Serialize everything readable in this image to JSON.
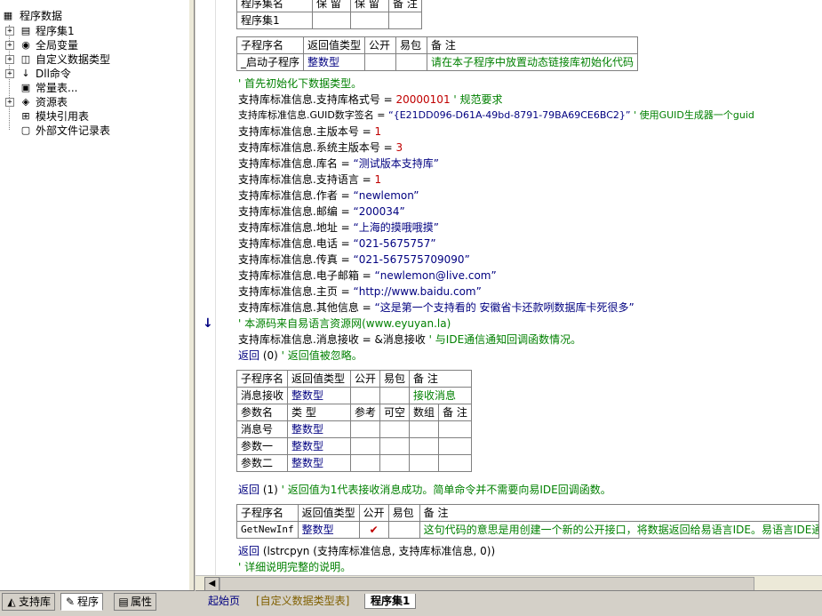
{
  "tree": {
    "root": "程序数据",
    "items": [
      {
        "label": "程序集1",
        "icon": "program-set-icon"
      },
      {
        "label": "全局变量",
        "icon": "global-var-icon"
      },
      {
        "label": "自定义数据类型",
        "icon": "custom-type-icon"
      },
      {
        "label": "Dll命令",
        "icon": "dll-icon"
      },
      {
        "label": "常量表...",
        "icon": "constant-icon"
      },
      {
        "label": "资源表",
        "icon": "resource-icon"
      },
      {
        "label": "模块引用表",
        "icon": "module-ref-icon"
      },
      {
        "label": "外部文件记录表",
        "icon": "external-file-icon"
      }
    ]
  },
  "left_tabs": [
    {
      "label": "支持库",
      "icon": "library-icon"
    },
    {
      "label": "程序",
      "icon": "program-icon"
    },
    {
      "label": "属性",
      "icon": "properties-icon"
    }
  ],
  "top_table": {
    "headers": [
      "程序集名",
      "保 留",
      "保 留",
      "备 注"
    ],
    "row": [
      "程序集1",
      "",
      "",
      ""
    ]
  },
  "sub1": {
    "headers": [
      "子程序名",
      "返回值类型",
      "公开",
      "易包",
      "备 注"
    ],
    "row": [
      "_启动子程序",
      "整数型",
      "",
      "",
      "请在本子程序中放置动态链接库初始化代码"
    ]
  },
  "code_lines": {
    "l1": "' 首先初始化下数据类型。",
    "l2a": "支持库标准信息.支持库格式号 = ",
    "l2b": "20000101",
    "l2c": "  ' 规范要求",
    "l3a": "支持库标准信息.GUID数字签名 = ",
    "l3b": "“{E21DD096-D61A-49bd-8791-79BA69CE6BC2}”",
    "l3c": "  ' 使用GUID生成器一个guid",
    "l4a": "支持库标准信息.主版本号 = ",
    "l4b": "1",
    "l5a": "支持库标准信息.系统主版本号 = ",
    "l5b": "3",
    "l6a": "支持库标准信息.库名 = ",
    "l6b": "“测试版本支持库”",
    "l7a": "支持库标准信息.支持语言 = ",
    "l7b": "1",
    "l8a": "支持库标准信息.作者 = ",
    "l8b": "“newlemon”",
    "l9a": "支持库标准信息.邮编 = ",
    "l9b": "“200034”",
    "l10a": "支持库标准信息.地址 = ",
    "l10b": "“上海的摸哦哦摸”",
    "l11a": "支持库标准信息.电话 = ",
    "l11b": "“021-5675757”",
    "l12a": "支持库标准信息.传真 = ",
    "l12b": "“021-567575709090”",
    "l13a": "支持库标准信息.电子邮箱 = ",
    "l13b": "“newlemon@live.com”",
    "l14a": "支持库标准信息.主页 = ",
    "l14b": "“http://www.baidu.com”",
    "l15a": "支持库标准信息.其他信息 = ",
    "l15b": "“这是第一个支持看的 安徽省卡还款咧数据库卡死很多”",
    "l16": "' 本源码来自易语言资源网(www.eyuyan.la)",
    "l17a": "支持库标准信息.消息接收 = &消息接收",
    "l17b": "  ' 与IDE通信通知回调函数情况。",
    "l18a": "返回",
    "l18b": " (0)",
    "l18c": "  ' 返回值被忽略。",
    "l19a": "返回",
    "l19b": " (1)",
    "l19c": "  ' 返回值为1代表接收消息成功。简单命令并不需要向易IDE回调函数。",
    "l20a": "返回",
    "l20b": " (lstrcpyn (支持库标准信息, 支持库标准信息, 0))",
    "l21": "' 详细说明完整的说明。"
  },
  "sub2": {
    "headers": [
      "子程序名",
      "返回值类型",
      "公开",
      "易包",
      "备 注"
    ],
    "row": [
      "消息接收",
      "整数型",
      "",
      "",
      "接收消息"
    ],
    "param_headers": [
      "参数名",
      "类 型",
      "参考",
      "可空",
      "数组",
      "备 注"
    ],
    "params": [
      [
        "消息号",
        "整数型",
        "",
        "",
        "",
        ""
      ],
      [
        "参数一",
        "整数型",
        "",
        "",
        "",
        ""
      ],
      [
        "参数二",
        "整数型",
        "",
        "",
        "",
        ""
      ]
    ]
  },
  "sub3": {
    "headers": [
      "子程序名",
      "返回值类型",
      "公开",
      "易包",
      "备 注"
    ],
    "row": [
      "GetNewInf",
      "整数型",
      "✔",
      "",
      "这句代码的意思是用创建一个新的公开接口，将数据返回给易语言IDE。易语言IDE通"
    ]
  },
  "editor_tabs": [
    "起始页",
    "[自定义数据类型表]",
    "程序集1"
  ],
  "colors": {
    "keyword": "#000080",
    "comment": "#008000",
    "number": "#c00000"
  }
}
